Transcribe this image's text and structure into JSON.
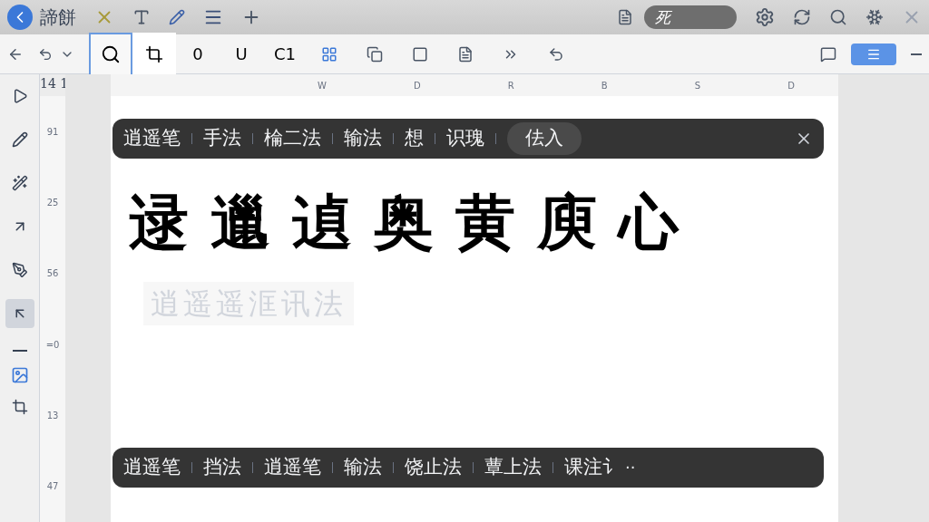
{
  "title_bar": {
    "app_name": "諦餅",
    "search": {
      "value": "死"
    }
  },
  "toolbar": {
    "tools": [
      {
        "kind": "icon",
        "selected": true
      },
      {
        "kind": "icon",
        "selected": false
      },
      {
        "kind": "text",
        "label": "0",
        "selected": false
      },
      {
        "kind": "text",
        "label": "U",
        "selected": false
      },
      {
        "kind": "text",
        "label": "C1",
        "selected": false
      }
    ],
    "mode_button": {
      "selected": true
    }
  },
  "ruler": {
    "corner": "14 1",
    "columns": [
      "W",
      "D",
      "R",
      "B",
      "S",
      "D"
    ],
    "rows": [
      "91",
      "25",
      "56",
      "=0",
      "13",
      "47"
    ]
  },
  "sidebar": {
    "tools": [
      {
        "selected": false
      },
      {
        "selected": false
      },
      {
        "selected": false
      },
      {
        "selected": false
      },
      {
        "selected": false
      },
      {
        "selected": true
      }
    ]
  },
  "top_candidates": [
    {
      "label": "逍遥笔",
      "selected": false
    },
    {
      "label": "手法",
      "selected": false
    },
    {
      "label": "棆二法",
      "selected": false
    },
    {
      "label": "输法",
      "selected": false
    },
    {
      "label": "想",
      "selected": false
    },
    {
      "label": "识瑰",
      "selected": false
    },
    {
      "label": "佉入",
      "selected": true
    }
  ],
  "handwriting": {
    "characters": [
      "逯",
      "邋",
      "遉",
      "奥",
      "黄",
      "庾",
      "心"
    ],
    "faded_line": "逍遥遥洭讯法"
  },
  "bottom_candidates": [
    {
      "label": "逍遥笔",
      "selected": false
    },
    {
      "label": "挡法",
      "selected": false
    },
    {
      "label": "逍遥笔",
      "selected": false
    },
    {
      "label": "输法",
      "selected": false
    },
    {
      "label": "饶止法",
      "selected": false
    },
    {
      "label": "蕈上法",
      "selected": false
    },
    {
      "label": "课注讠",
      "selected": false
    }
  ],
  "bottom_more": "··"
}
